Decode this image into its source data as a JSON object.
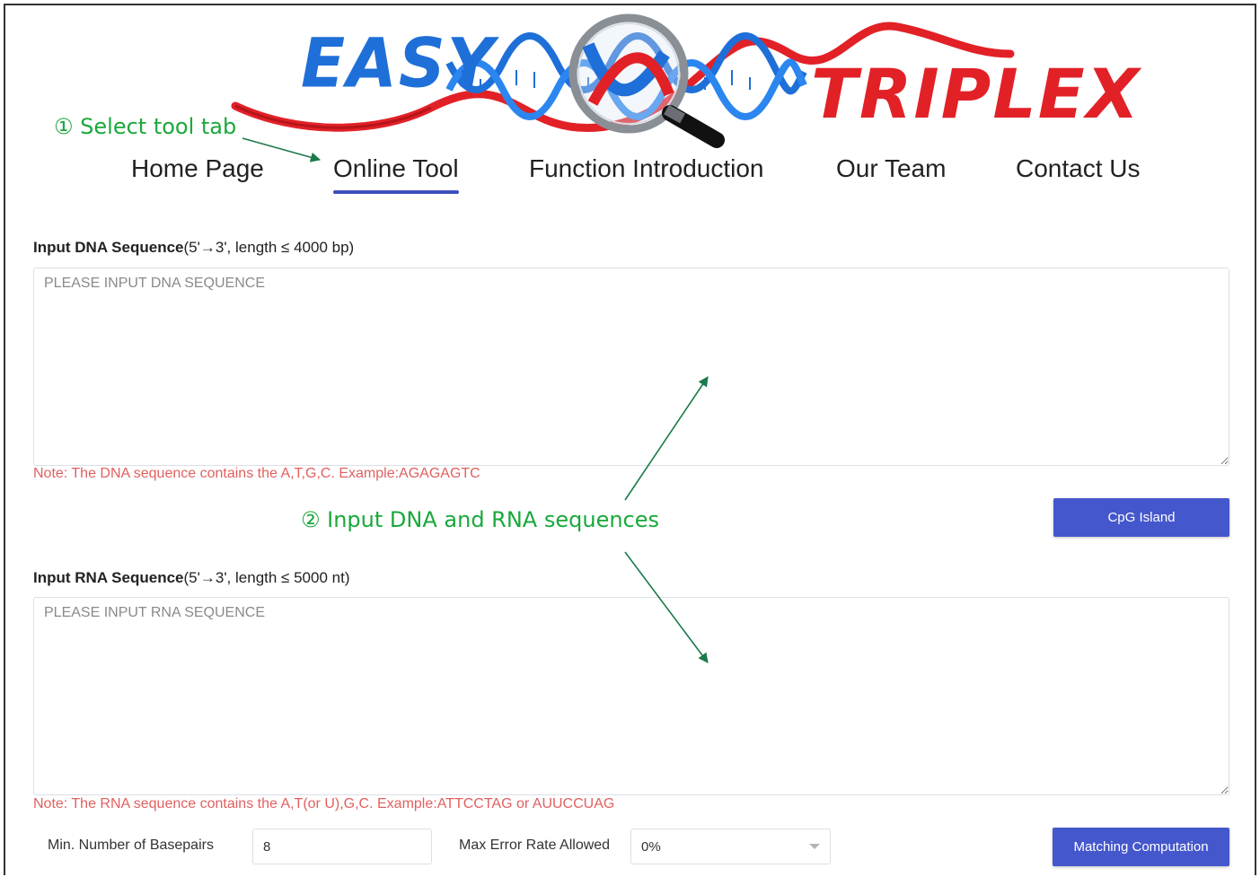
{
  "logo": {
    "word_left": "EASY",
    "word_right": "TRIPLEX",
    "colors": {
      "easy": "#1f6fd8",
      "triplex": "#e22127",
      "ribbon": "#e22127",
      "helix": "#1f6fd8"
    }
  },
  "nav": {
    "items": [
      {
        "label": "Home Page"
      },
      {
        "label": "Online Tool"
      },
      {
        "label": "Function Introduction"
      },
      {
        "label": "Our Team"
      },
      {
        "label": "Contact Us"
      }
    ],
    "active_index": 1,
    "active_color": "#3d4fbf"
  },
  "annotations": {
    "step1": "① Select tool tab",
    "step2": "② Input DNA and RNA sequences",
    "color": "#1aa83c"
  },
  "dna": {
    "label_bold": "Input DNA Sequence",
    "label_rest": "(5'→3', length ≤ 4000 bp)",
    "placeholder": "PLEASE INPUT DNA SEQUENCE",
    "value": "",
    "note": "Note: The DNA sequence contains the A,T,G,C. Example:AGAGAGTC"
  },
  "rna": {
    "label_bold": "Input RNA Sequence",
    "label_rest": "(5'→3', length ≤ 5000 nt)",
    "placeholder": "PLEASE INPUT RNA SEQUENCE",
    "value": "",
    "note": "Note: The RNA sequence contains the A,T(or U),G,C. Example:ATTCCTAG or AUUCCUAG"
  },
  "buttons": {
    "cpg": "CpG Island",
    "match": "Matching Computation",
    "color": "#4557cc"
  },
  "params": {
    "min_basepairs_label": "Min. Number of Basepairs",
    "min_basepairs_value": "8",
    "max_error_label": "Max Error Rate Allowed",
    "max_error_value": "0%"
  },
  "note_color": "#e06060"
}
